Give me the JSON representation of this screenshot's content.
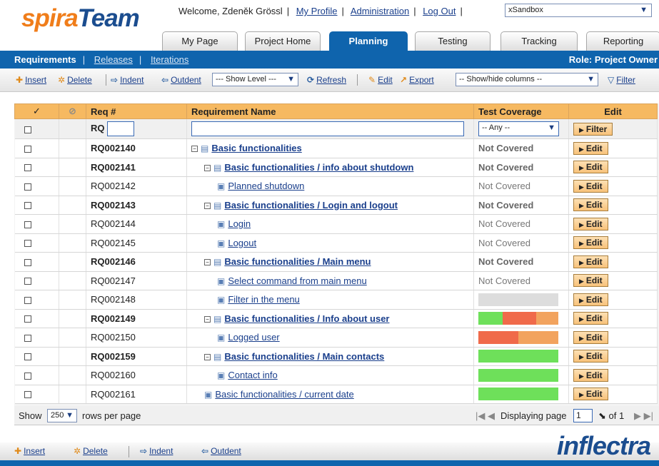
{
  "header": {
    "logo_part1": "spira",
    "logo_part2": "Team",
    "welcome": "Welcome, Zdeněk Grössl",
    "links": [
      "My Profile",
      "Administration",
      "Log Out"
    ],
    "project_select": "xSandbox"
  },
  "tabs": [
    "My Page",
    "Project Home",
    "Planning",
    "Testing",
    "Tracking",
    "Reporting"
  ],
  "active_tab": "Planning",
  "subnav": {
    "items": [
      "Requirements",
      "Releases",
      "Iterations"
    ],
    "role": "Role: Project Owner"
  },
  "toolbar": {
    "insert": "Insert",
    "delete": "Delete",
    "indent": "Indent",
    "outdent": "Outdent",
    "show_level": "--- Show Level ---",
    "refresh": "Refresh",
    "edit": "Edit",
    "export": "Export",
    "show_hide": "-- Show/hide columns --",
    "filter": "Filter"
  },
  "columns": {
    "req": "Req #",
    "name": "Requirement Name",
    "coverage": "Test Coverage",
    "edit": "Edit"
  },
  "filter_row": {
    "req_prefix": "RQ",
    "coverage_any": "-- Any --",
    "filter_btn": "Filter"
  },
  "rows": [
    {
      "id": "RQ002140",
      "name": "Basic functionalities",
      "level": 0,
      "summary": true,
      "coverage": "Not Covered"
    },
    {
      "id": "RQ002141",
      "name": "Basic functionalities / info about shutdown",
      "level": 1,
      "summary": true,
      "coverage": "Not Covered"
    },
    {
      "id": "RQ002142",
      "name": "Planned shutdown",
      "level": 2,
      "summary": false,
      "coverage": "Not Covered"
    },
    {
      "id": "RQ002143",
      "name": "Basic functionalities / Login and logout",
      "level": 1,
      "summary": true,
      "coverage": "Not Covered"
    },
    {
      "id": "RQ002144",
      "name": "Login",
      "level": 2,
      "summary": false,
      "coverage": "Not Covered"
    },
    {
      "id": "RQ002145",
      "name": "Logout",
      "level": 2,
      "summary": false,
      "coverage": "Not Covered"
    },
    {
      "id": "RQ002146",
      "name": "Basic functionalities / Main menu",
      "level": 1,
      "summary": true,
      "coverage": "Not Covered"
    },
    {
      "id": "RQ002147",
      "name": "Select command from main menu",
      "level": 2,
      "summary": false,
      "coverage": "Not Covered"
    },
    {
      "id": "RQ002148",
      "name": "Filter in the menu",
      "level": 2,
      "summary": false,
      "bar": [
        [
          "#dddddd",
          1
        ]
      ]
    },
    {
      "id": "RQ002149",
      "name": "Basic functionalities / Info about user",
      "level": 1,
      "summary": true,
      "bar": [
        [
          "#6ee05a",
          0.3
        ],
        [
          "#f06a4a",
          0.42
        ],
        [
          "#f2a35e",
          0.28
        ]
      ]
    },
    {
      "id": "RQ002150",
      "name": "Logged user",
      "level": 2,
      "summary": false,
      "bar": [
        [
          "#f06a4a",
          0.5
        ],
        [
          "#f2a35e",
          0.5
        ]
      ]
    },
    {
      "id": "RQ002159",
      "name": "Basic functionalities / Main contacts",
      "level": 1,
      "summary": true,
      "bar": [
        [
          "#6ee05a",
          1
        ]
      ]
    },
    {
      "id": "RQ002160",
      "name": "Contact info",
      "level": 2,
      "summary": false,
      "bar": [
        [
          "#6ee05a",
          1
        ]
      ]
    },
    {
      "id": "RQ002161",
      "name": "Basic functionalities / current date",
      "level": 1,
      "summary": false,
      "bar": [
        [
          "#6ee05a",
          1
        ]
      ]
    }
  ],
  "edit_label": "Edit",
  "pager": {
    "show": "Show",
    "rows_value": "250",
    "rows_per_page": "rows per page",
    "displaying": "Displaying page",
    "page": "1",
    "of": "of 1"
  },
  "bottom": {
    "insert": "Insert",
    "delete": "Delete",
    "indent": "Indent",
    "outdent": "Outdent",
    "brand": "inflectra"
  },
  "colors": {
    "nav_blue": "#0f64ad",
    "header_orange": "#f6b961",
    "brand_orange": "#f07d1a",
    "green": "#6ee05a",
    "red": "#f06a4a"
  }
}
